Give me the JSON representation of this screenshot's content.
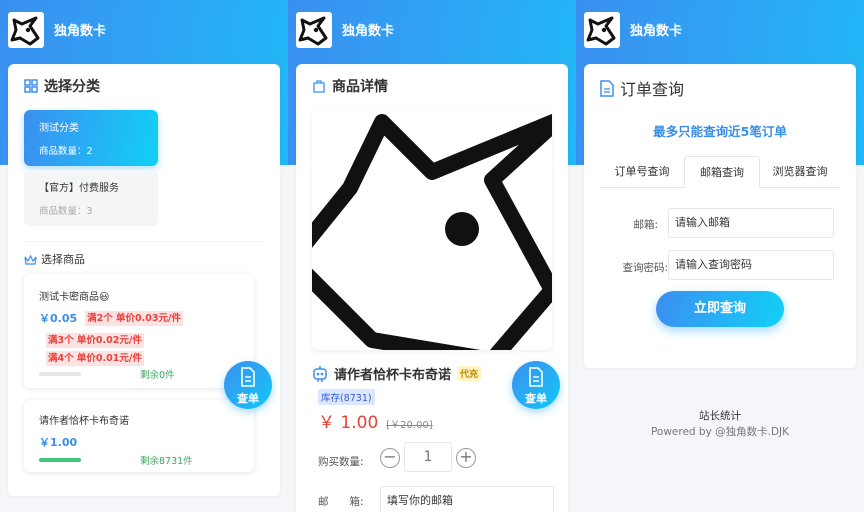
{
  "brand": {
    "name": "独角数卡"
  },
  "panel1": {
    "category_title": "选择分类",
    "categories": [
      {
        "name": "测试分类",
        "count": "商品数量：2"
      },
      {
        "name": "【官方】付费服务",
        "count": "商品数量：3"
      }
    ],
    "goods_title": "选择商品",
    "goods": [
      {
        "name": "测试卡密商品😃",
        "price": "￥0.05",
        "tags": [
          "满2个 单价0.03元/件",
          "满3个 单价0.02元/件",
          "满4个 单价0.01元/件"
        ],
        "stock": "剩余0件",
        "stock_fraction": 0
      },
      {
        "name": "请作者恰杯卡布奇诺",
        "price": "￥1.00",
        "stock": "剩余8731件",
        "stock_fraction": 1
      }
    ],
    "fab_label": "查单"
  },
  "panel2": {
    "detail_title": "商品详情",
    "product_name": "请作者恰杯卡布奇诺",
    "type_badge": "代充",
    "stock_badge": "库存(8731)",
    "price": "￥ 1.00",
    "orig_price": "[￥20.00]",
    "qty_label": "购买数量:",
    "qty_value": "1",
    "minus": "−",
    "plus": "+",
    "email_label": "邮　　箱:",
    "email_placeholder": "填写你的邮箱",
    "fab_label": "查单"
  },
  "panel3": {
    "title": "订单查询",
    "notice": "最多只能查询近5笔订单",
    "tabs": [
      "订单号查询",
      "邮箱查询",
      "浏览器查询"
    ],
    "active_tab": 1,
    "email_label": "邮箱:",
    "email_placeholder": "请输入邮箱",
    "pwd_label": "查询密码:",
    "pwd_placeholder": "请输入查询密码",
    "submit": "立即查询",
    "footer_stats": "站长统计",
    "footer_powered": "Powered by @独角数卡.DJK"
  },
  "colors": {
    "primary": "#3b8ff0",
    "accent": "#13c7f7",
    "price_red": "#e8423b",
    "stock_green": "#37a85c"
  }
}
